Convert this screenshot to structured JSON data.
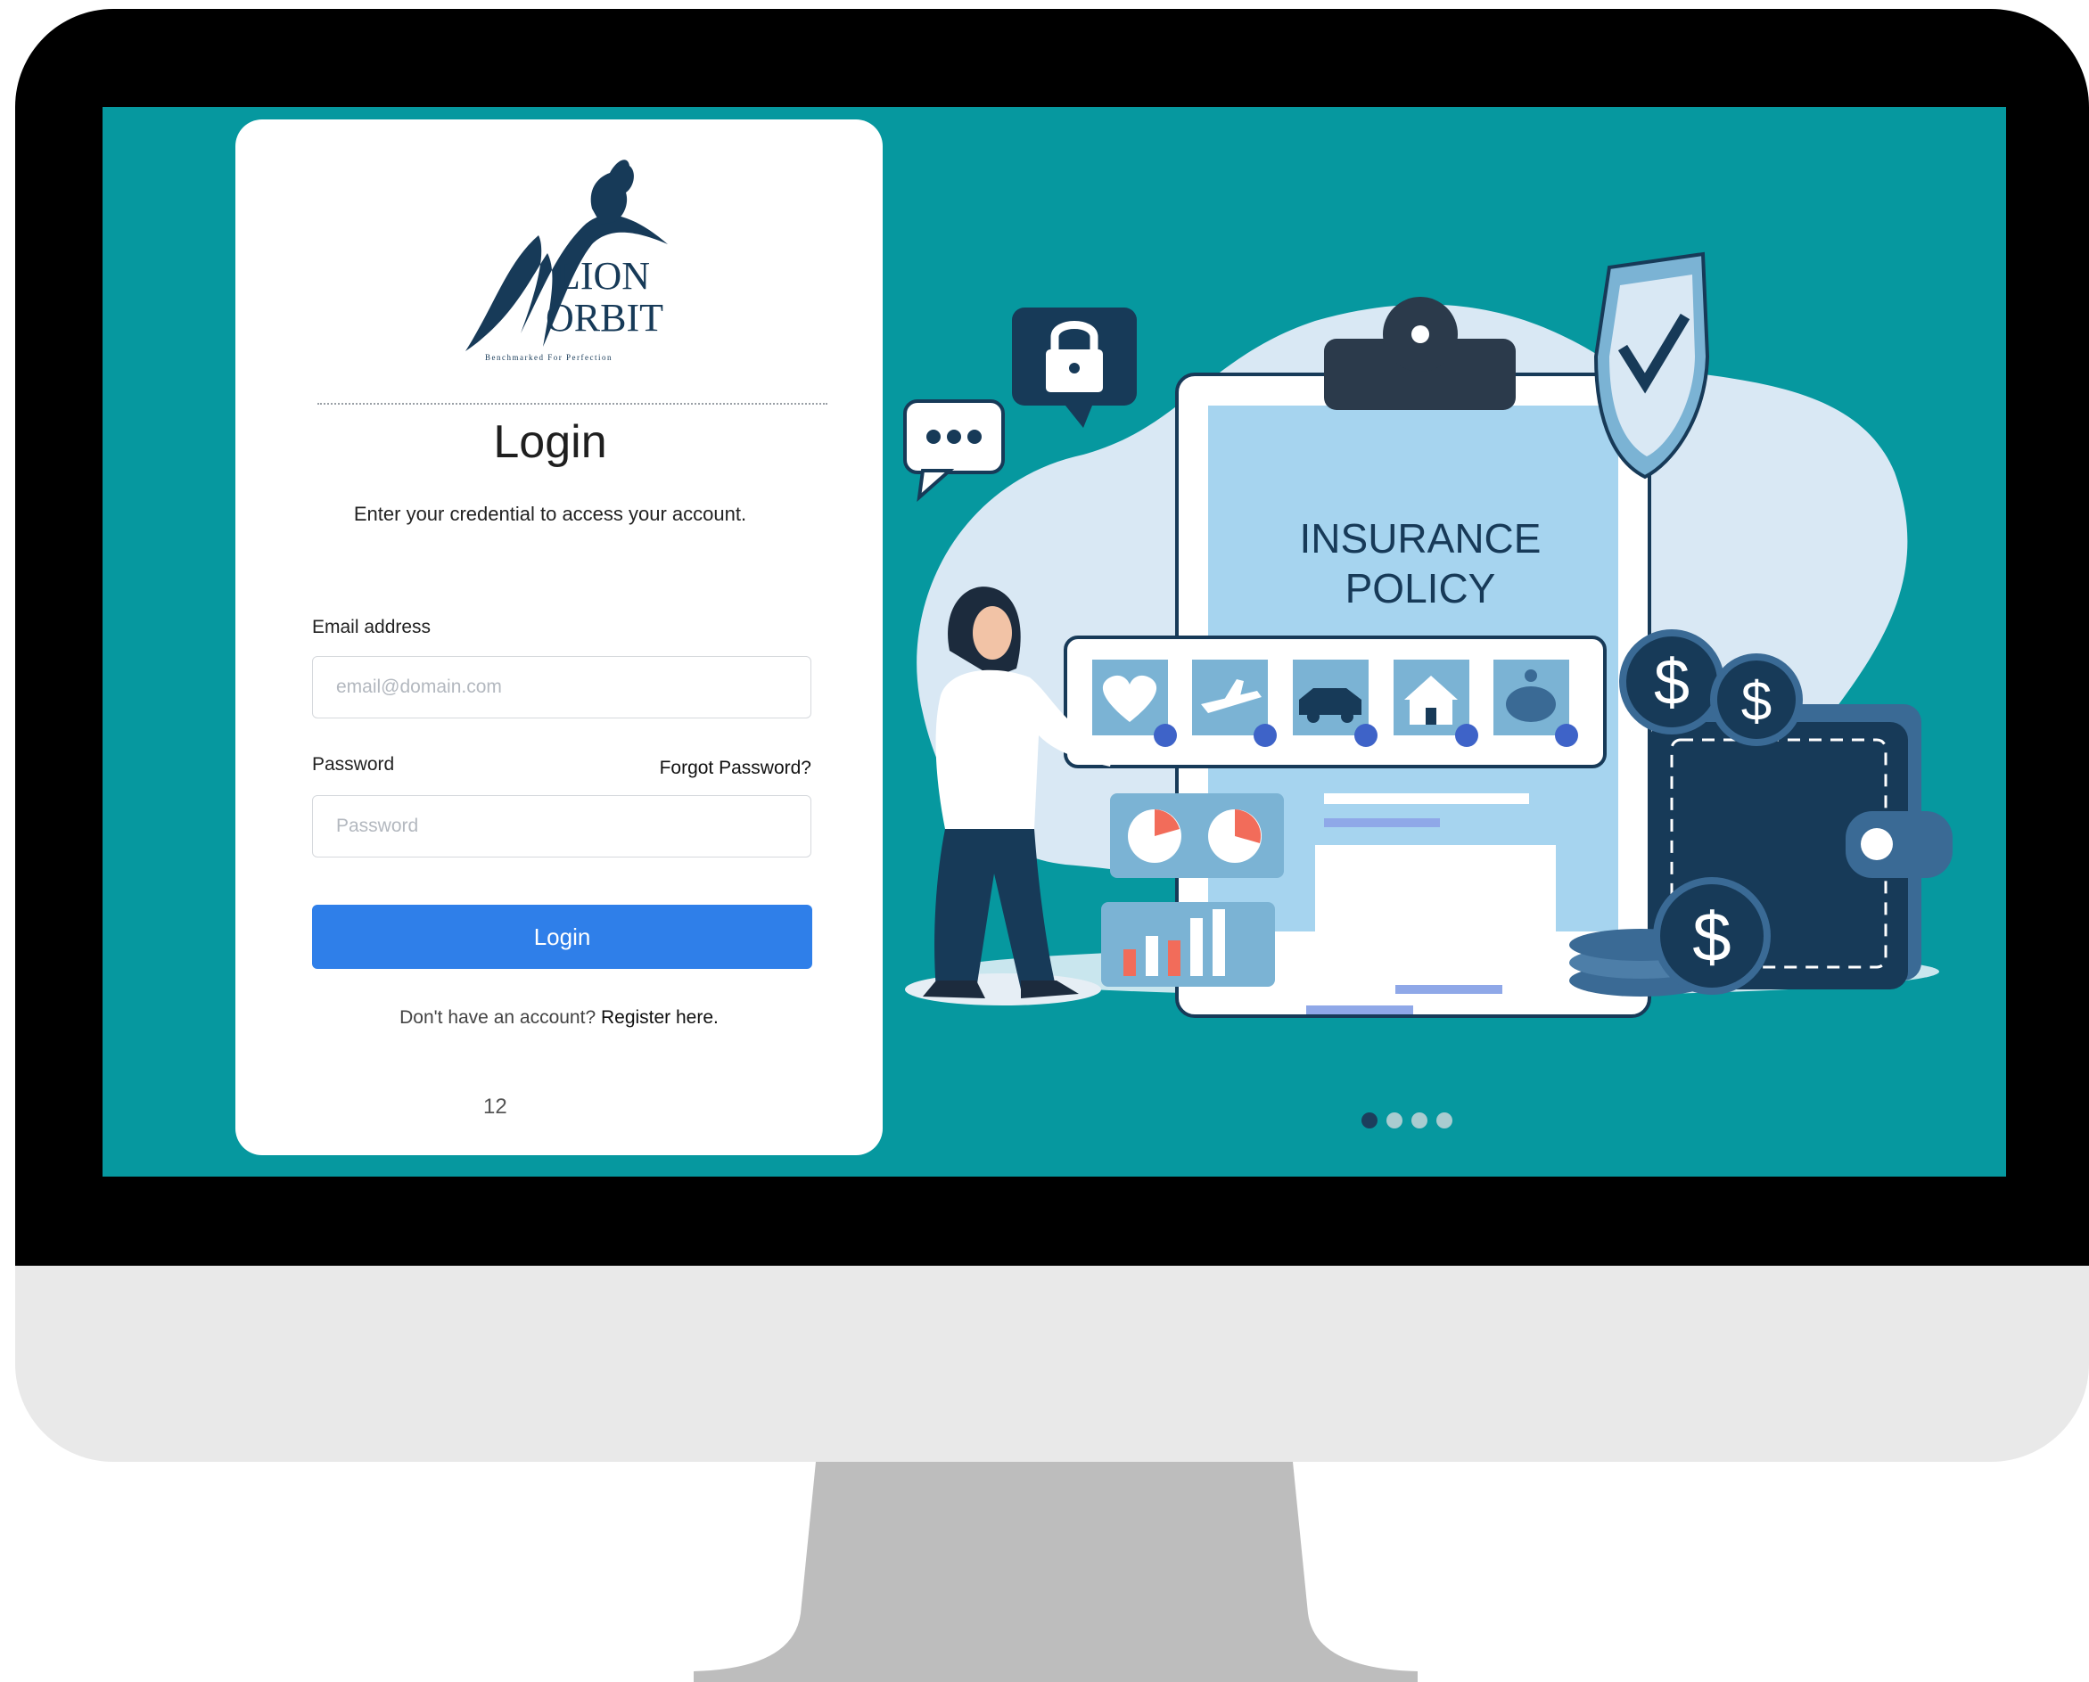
{
  "brand": {
    "name_line1": "LION",
    "name_line2": "ORBIT",
    "tagline": "Benchmarked For Perfection"
  },
  "login": {
    "title": "Login",
    "subtitle": "Enter your credential to access your account.",
    "email_label": "Email address",
    "email_placeholder": "email@domain.com",
    "password_label": "Password",
    "password_placeholder": "Password",
    "forgot_label": "Forgot Password?",
    "submit_label": "Login",
    "register_prompt": "Don't have an account?",
    "register_link": "Register here.",
    "page_number": "12"
  },
  "illustration": {
    "heading_line1": "INSURANCE",
    "heading_line2": "POLICY",
    "currency_symbol": "$",
    "icons": [
      "heart-icon",
      "airplane-icon",
      "car-icon",
      "house-icon",
      "piggy-bank-icon"
    ]
  },
  "carousel": {
    "total": 4,
    "active_index": 0
  },
  "colors": {
    "screen_bg": "#06989f",
    "button": "#2f7fe9",
    "navy": "#173a58",
    "light_blue": "#a6d4ef"
  }
}
